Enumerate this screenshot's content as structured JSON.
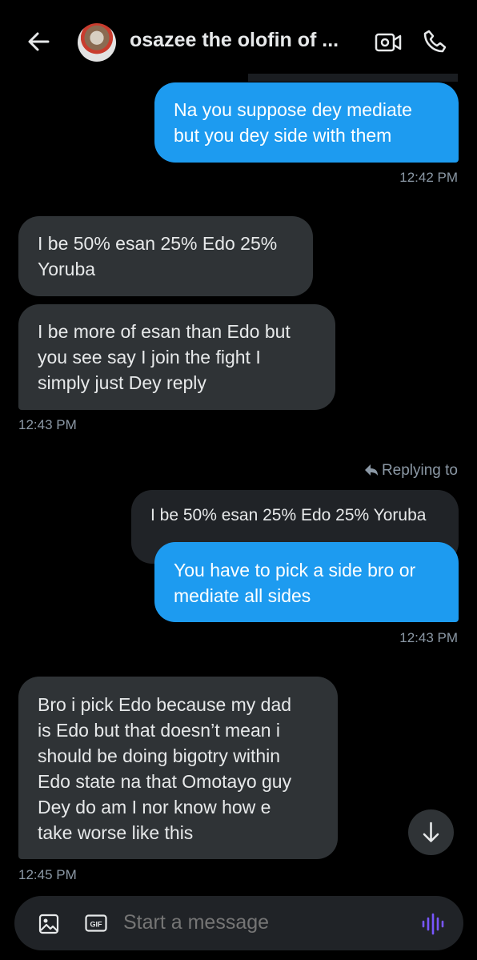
{
  "header": {
    "title": "osazee the olofin of ..."
  },
  "messages": [
    {
      "side": "sent",
      "lines": [
        "Na you suppose dey mediate",
        "but you dey side with them"
      ],
      "time": "12:42 PM"
    },
    {
      "side": "received",
      "lines": [
        "I be 50% esan 25% Edo 25%",
        "Yoruba"
      ]
    },
    {
      "side": "received",
      "lines": [
        "I be more of esan than Edo but",
        "you see say I join the fight I",
        "simply just Dey reply"
      ],
      "time": "12:43 PM"
    },
    {
      "side": "sent",
      "replying_label": "Replying to",
      "quoted": "I be 50% esan 25% Edo 25% Yoruba",
      "lines": [
        "You have to pick a side bro or",
        "mediate all sides"
      ],
      "time": "12:43 PM"
    },
    {
      "side": "received",
      "lines": [
        "Bro i pick Edo because my dad",
        "is Edo but that doesn’t mean i",
        "should be doing bigotry within",
        "Edo state na that Omotayo guy",
        "Dey do am I nor know how e",
        "take worse like this"
      ],
      "time": "12:45 PM"
    }
  ],
  "composer": {
    "placeholder": "Start a message"
  },
  "icons": {
    "back": "back-arrow-icon",
    "video": "video-call-icon",
    "phone": "phone-call-icon",
    "image": "image-icon",
    "gif": "gif-icon",
    "voice": "voice-message-icon",
    "scroll": "scroll-down-icon",
    "reply": "reply-arrow-icon"
  },
  "colors": {
    "accent": "#1d9bf0",
    "voice": "#7856ff",
    "background": "#000000"
  }
}
